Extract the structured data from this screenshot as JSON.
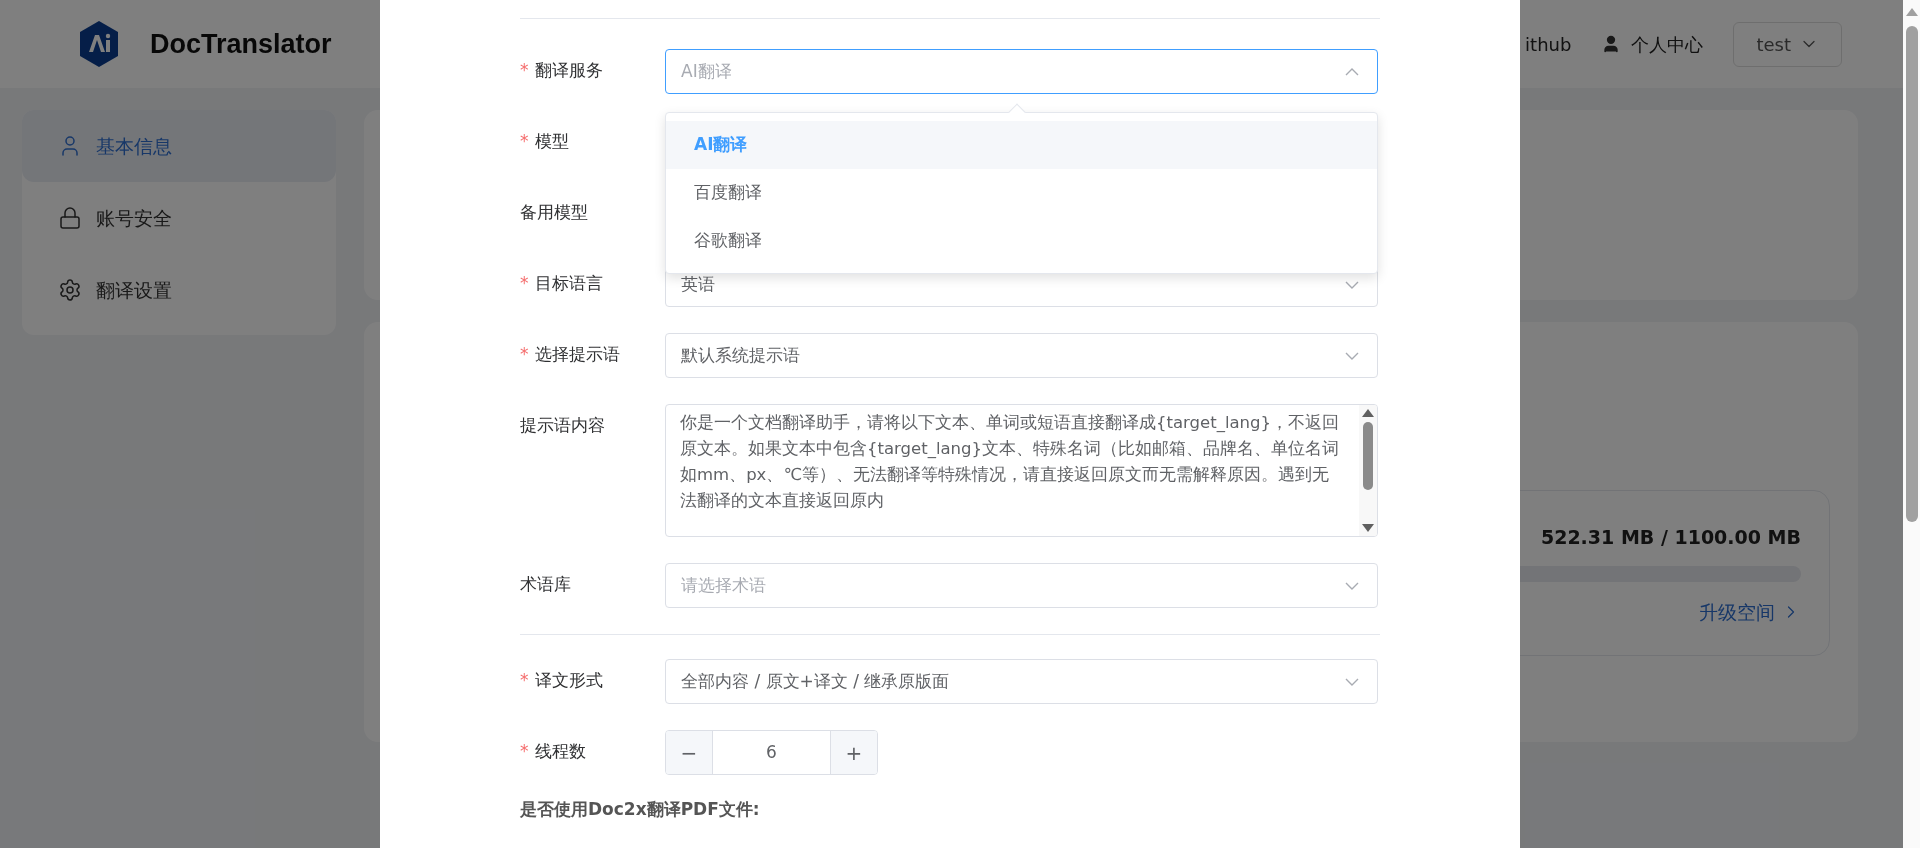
{
  "header": {
    "brand": "DocTranslator",
    "links": [
      {
        "label": "ithub",
        "kind": "text"
      },
      {
        "label": "个人中心",
        "kind": "user"
      }
    ],
    "user_menu": "test"
  },
  "sidebar": {
    "items": [
      {
        "label": "基本信息",
        "kind": "user",
        "selected": true
      },
      {
        "label": "账号安全",
        "kind": "lock",
        "selected": false
      },
      {
        "label": "翻译设置",
        "kind": "gear",
        "selected": false
      }
    ]
  },
  "storage": {
    "usage": "522.31 MB / 1100.00 MB",
    "upgrade_link": "升级空间"
  },
  "dialog": {
    "fields": [
      {
        "label": "翻译服务",
        "mark": "*",
        "kind": "select",
        "placeholder": "AI翻译",
        "focused": true
      },
      {
        "label": "模型",
        "mark": "*",
        "kind": "hidden"
      },
      {
        "label": "备用模型",
        "kind": "hidden"
      },
      {
        "label": "目标语言",
        "mark": "*",
        "kind": "select",
        "value": "英语",
        "focused": false
      },
      {
        "label": "选择提示语",
        "mark": "*",
        "kind": "select",
        "value": "默认系统提示语",
        "focused": false
      },
      {
        "label": "提示语内容",
        "kind": "textarea",
        "value": "你是一个文档翻译助手，请将以下文本、单词或短语直接翻译成{target_lang}，不返回原文本。如果文本中包含{target_lang}文本、特殊名词（比如邮箱、品牌名、单位名词如mm、px、℃等）、无法翻译等特殊情况，请直接返回原文而无需解释原因。遇到无法翻译的文本直接返回原内"
      },
      {
        "label": "术语库",
        "kind": "select",
        "placeholder": "请选择术语",
        "focused": false
      },
      {
        "kind": "divider"
      },
      {
        "label": "译文形式",
        "mark": "*",
        "kind": "select",
        "value": "全部内容 / 原文+译文 / 继承原版面",
        "focused": false
      },
      {
        "label": "线程数",
        "mark": "*",
        "kind": "stepper",
        "value": "6",
        "minus": "−",
        "plus": "+"
      }
    ],
    "dropdown_options": [
      {
        "label": "AI翻译",
        "selected": true
      },
      {
        "label": "百度翻译",
        "selected": false
      },
      {
        "label": "谷歌翻译",
        "selected": false
      }
    ],
    "doc2x_label": "是否使用Doc2x翻译PDF文件:"
  }
}
